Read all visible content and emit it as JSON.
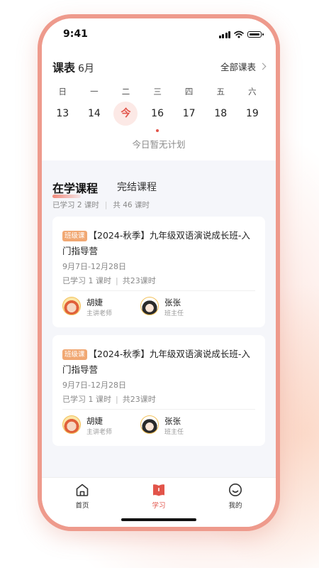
{
  "status_bar": {
    "time": "9:41"
  },
  "header": {
    "title": "课表",
    "month": "6月",
    "all_courses": "全部课表"
  },
  "week": [
    {
      "weekday": "日",
      "date": "13",
      "today": false,
      "has_class": false
    },
    {
      "weekday": "一",
      "date": "14",
      "today": false,
      "has_class": false
    },
    {
      "weekday": "二",
      "date": "今",
      "today": true,
      "has_class": false
    },
    {
      "weekday": "三",
      "date": "16",
      "today": false,
      "has_class": true
    },
    {
      "weekday": "四",
      "date": "17",
      "today": false,
      "has_class": false
    },
    {
      "weekday": "五",
      "date": "18",
      "today": false,
      "has_class": false
    },
    {
      "weekday": "六",
      "date": "19",
      "today": false,
      "has_class": false
    }
  ],
  "no_plan_text": "今日暂无计划",
  "tabs": {
    "active": "在学课程",
    "inactive": "完结课程"
  },
  "summary": {
    "studied": "已学习 2 课时",
    "total": "共 46 课时"
  },
  "courses": [
    {
      "badge": "班级课",
      "title": "【2024-秋季】九年级双语演说成长班-入门指导营",
      "date_range": "9月7日-12月28日",
      "studied": "已学习 1 课时",
      "total": "共23课时",
      "teacher": {
        "name": "胡婕",
        "role": "主讲老师"
      },
      "head_teacher": {
        "name": "张张",
        "role": "班主任"
      }
    },
    {
      "badge": "班级课",
      "title": "【2024-秋季】九年级双语演说成长班-入门指导营",
      "date_range": "9月7日-12月28日",
      "studied": "已学习 1 课时",
      "total": "共23课时",
      "teacher": {
        "name": "胡婕",
        "role": "主讲老师"
      },
      "head_teacher": {
        "name": "张张",
        "role": "班主任"
      }
    }
  ],
  "tabbar": {
    "home": {
      "label": "首页",
      "icon": "home-icon"
    },
    "study": {
      "label": "学习",
      "icon": "book-icon",
      "active": true
    },
    "mine": {
      "label": "我的",
      "icon": "smile-icon"
    }
  },
  "colors": {
    "accent": "#e2544a",
    "badge": "#f1a873",
    "frame": "#ee9a8c"
  }
}
